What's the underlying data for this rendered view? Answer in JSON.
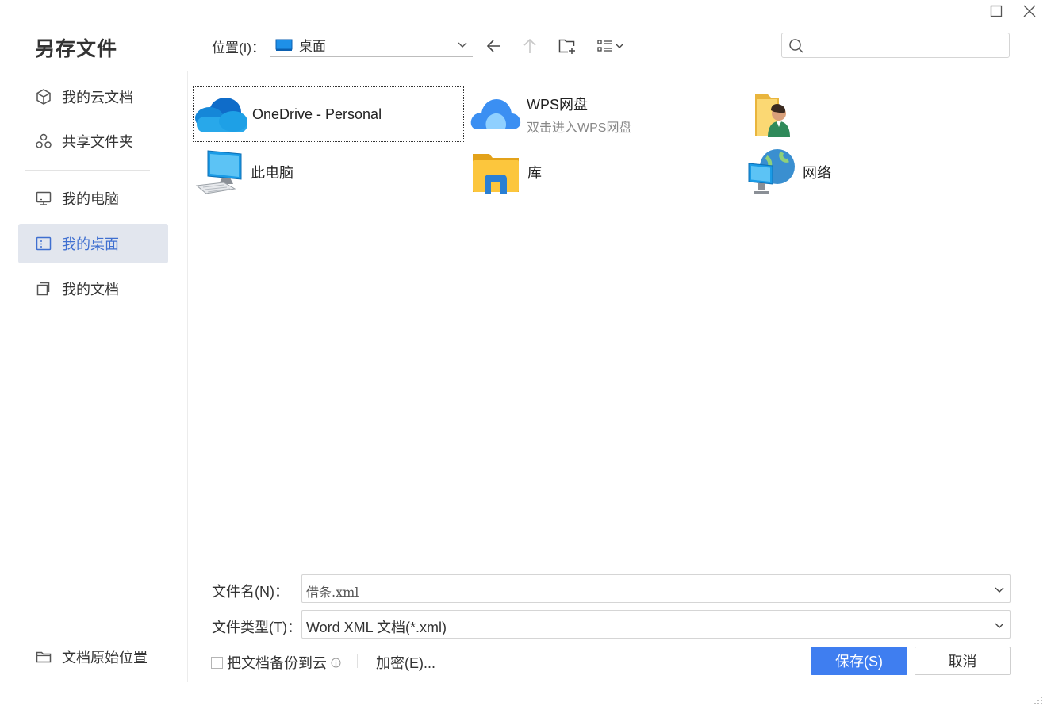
{
  "dialog": {
    "title": "另存文件"
  },
  "window_controls": {
    "maximize": "maximize-icon",
    "close": "close-icon"
  },
  "sidebar": {
    "items": [
      {
        "label": "我的云文档",
        "icon": "cube-icon"
      },
      {
        "label": "共享文件夹",
        "icon": "share-icon"
      },
      {
        "label": "我的电脑",
        "icon": "monitor-icon"
      },
      {
        "label": "我的桌面",
        "icon": "desktop-icon",
        "active": true
      },
      {
        "label": "我的文档",
        "icon": "documents-icon"
      }
    ],
    "footer_label": "文档原始位置"
  },
  "location": {
    "label": "位置(I)：",
    "value": "桌面"
  },
  "toolbar": {
    "back": "arrow-left-icon",
    "up": "arrow-up-icon",
    "new_folder": "new-folder-icon",
    "view": "list-view-icon"
  },
  "search": {
    "placeholder": ""
  },
  "items": [
    {
      "name": "OneDrive - Personal",
      "icon": "onedrive-icon"
    },
    {
      "name": "WPS网盘",
      "subtitle": "双击进入WPS网盘",
      "icon": "wps-cloud-icon"
    },
    {
      "name": "",
      "icon": "user-folder-icon"
    },
    {
      "name": "此电脑",
      "icon": "computer-icon"
    },
    {
      "name": "库",
      "icon": "library-folder-icon"
    },
    {
      "name": "网络",
      "icon": "network-icon"
    }
  ],
  "filename": {
    "label": "文件名(N)：",
    "value": "借条.xml"
  },
  "filetype": {
    "label": "文件类型(T)：",
    "value": "Word XML 文档(*.xml)"
  },
  "backup": {
    "label": "把文档备份到云",
    "checked": false
  },
  "encrypt_label": "加密(E)...",
  "save_label": "保存(S)",
  "cancel_label": "取消",
  "colors": {
    "accent": "#3f7ef0",
    "active_bg": "#e2e6ee",
    "active_text": "#3f6fd0"
  }
}
